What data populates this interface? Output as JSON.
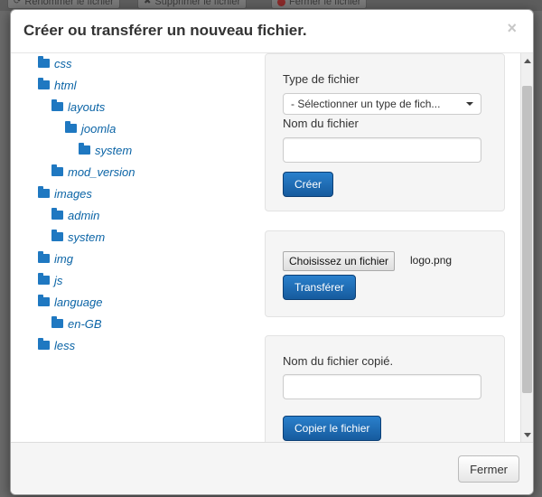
{
  "background_toolbar": {
    "rename_label": "Renommer le fichier",
    "delete_label": "Supprimer le fichier",
    "close_label": "Fermer le fichier"
  },
  "modal": {
    "title": "Créer ou transférer un nouveau fichier.",
    "close_glyph": "×"
  },
  "tree": [
    {
      "label": "css"
    },
    {
      "label": "html"
    },
    {
      "label": "layouts"
    },
    {
      "label": "joomla"
    },
    {
      "label": "system"
    },
    {
      "label": "mod_version"
    },
    {
      "label": "images"
    },
    {
      "label": "admin"
    },
    {
      "label": "system"
    },
    {
      "label": "img"
    },
    {
      "label": "js"
    },
    {
      "label": "language"
    },
    {
      "label": "en-GB"
    },
    {
      "label": "less"
    }
  ],
  "create_panel": {
    "type_label": "Type de fichier",
    "type_select_value": "- Sélectionner un type de fich...",
    "name_label": "Nom du fichier",
    "name_value": "",
    "create_button": "Créer"
  },
  "upload_panel": {
    "choose_button": "Choisissez un fichier",
    "chosen_file": "logo.png",
    "upload_button": "Transférer"
  },
  "copy_panel": {
    "copied_name_label": "Nom du fichier copié.",
    "copied_name_value": "",
    "copy_button": "Copier le fichier"
  },
  "footer": {
    "close_button": "Fermer"
  },
  "colors": {
    "primary_button": "#1f6db6",
    "folder_icon": "#1f78c1",
    "tree_link": "#0b64a6",
    "panel_bg": "#f5f5f5"
  }
}
